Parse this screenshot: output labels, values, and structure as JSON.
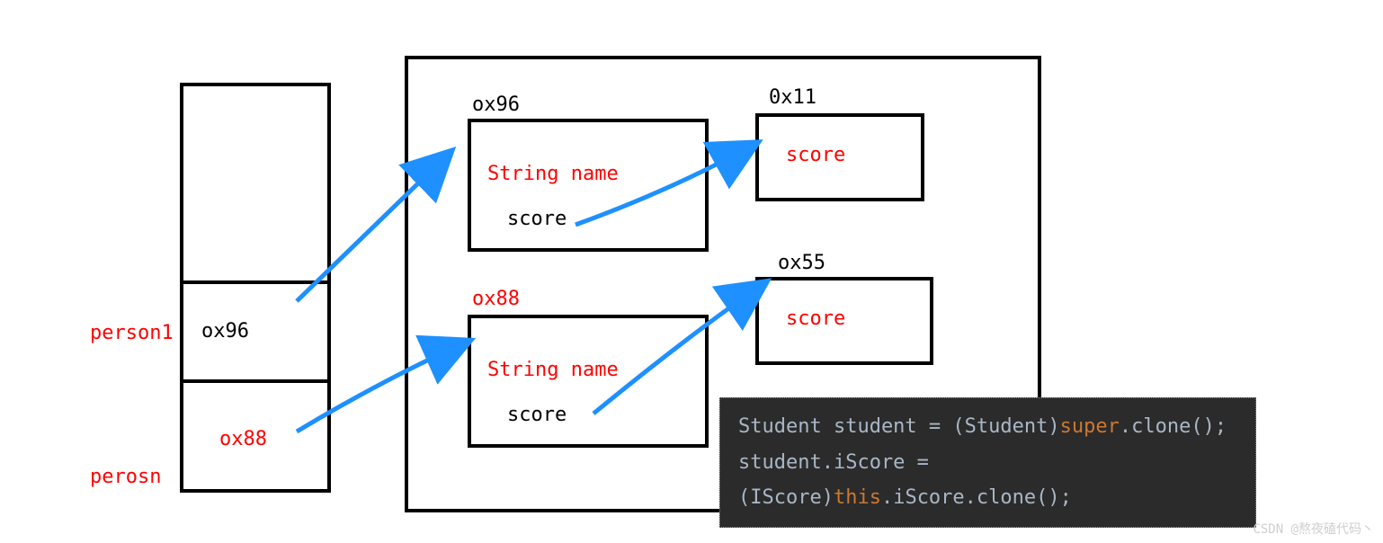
{
  "stack": {
    "var1_label": "person1",
    "var1_value": "ox96",
    "var2_label": "perosn",
    "var2_value": "ox88"
  },
  "heap": {
    "obj1_addr": "ox96",
    "obj1_field1": "String name",
    "obj1_field2": "score",
    "obj2_addr": "ox88",
    "obj2_field1": "String name",
    "obj2_field2": "score",
    "score1_addr": "0x11",
    "score1_field": "score",
    "score2_addr": "ox55",
    "score2_field": "score"
  },
  "code": {
    "l1_a": "Student student = (Student)",
    "l1_b": "super",
    "l1_c": ".clone();",
    "l2_a": "student.iScore = (IScore)",
    "l2_b": "this",
    "l2_c": ".iScore.clone();"
  },
  "watermark": "CSDN @熬夜磕代码丶"
}
